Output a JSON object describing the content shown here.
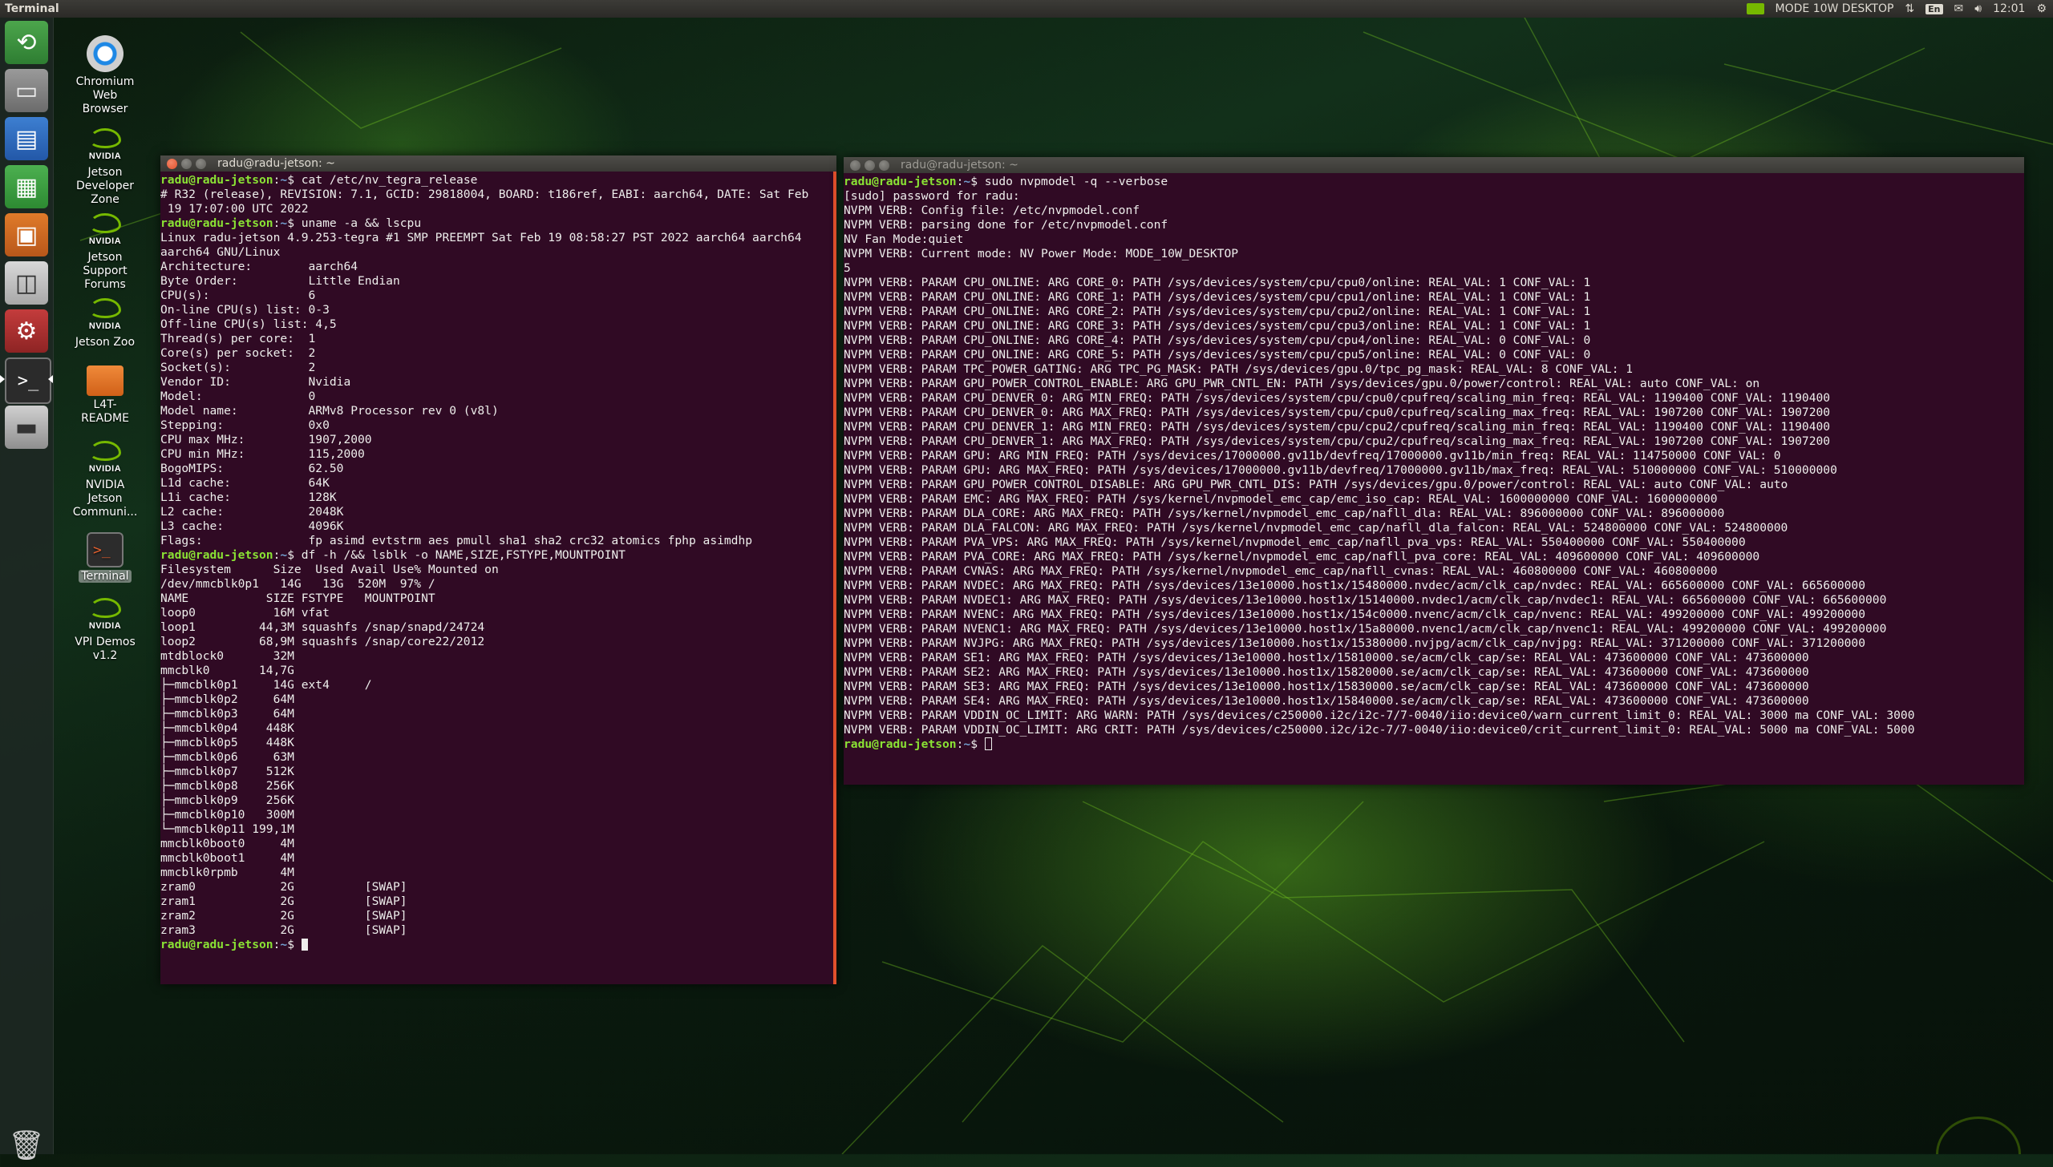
{
  "top_panel": {
    "app_title": "Terminal",
    "power_mode": "MODE 10W DESKTOP",
    "keyboard_layout": "En",
    "clock": "12:01"
  },
  "launcher": {
    "items": [
      "dash-home-icon",
      "files-icon",
      "libreoffice-writer-icon",
      "libreoffice-calc-icon",
      "libreoffice-impress-icon",
      "software-center-icon",
      "system-settings-icon",
      "terminal-icon",
      "drive-icon",
      "trash-icon"
    ]
  },
  "desktop": {
    "icons": [
      {
        "lines": [
          "Chromium",
          "Web",
          "Browser"
        ]
      },
      {
        "lines": [
          "Jetson",
          "Developer",
          "Zone"
        ]
      },
      {
        "lines": [
          "Jetson",
          "Support",
          "Forums"
        ]
      },
      {
        "lines": [
          "Jetson Zoo"
        ]
      },
      {
        "lines": [
          "L4T-",
          "README"
        ]
      },
      {
        "lines": [
          "NVIDIA",
          "Jetson",
          "Communi..."
        ]
      },
      {
        "lines": [
          "Terminal"
        ]
      },
      {
        "lines": [
          "VPI Demos",
          "v1.2"
        ]
      }
    ],
    "nvidia_label": "NVIDIA"
  },
  "terminal_left": {
    "title": "radu@radu-jetson: ~",
    "prompt_user": "radu@radu-jetson",
    "prompt_sep": ":",
    "prompt_path": "~",
    "prompt_end": "$ ",
    "lines": [
      {
        "p": true,
        "cmd": "cat /etc/nv_tegra_release"
      },
      {
        "t": "# R32 (release), REVISION: 7.1, GCID: 29818004, BOARD: t186ref, EABI: aarch64, DATE: Sat Feb"
      },
      {
        "t": " 19 17:07:00 UTC 2022"
      },
      {
        "p": true,
        "cmd": "uname -a && lscpu"
      },
      {
        "t": "Linux radu-jetson 4.9.253-tegra #1 SMP PREEMPT Sat Feb 19 08:58:27 PST 2022 aarch64 aarch64"
      },
      {
        "t": "aarch64 GNU/Linux"
      },
      {
        "t": "Architecture:        aarch64"
      },
      {
        "t": "Byte Order:          Little Endian"
      },
      {
        "t": "CPU(s):              6"
      },
      {
        "t": "On-line CPU(s) list: 0-3"
      },
      {
        "t": "Off-line CPU(s) list: 4,5"
      },
      {
        "t": "Thread(s) per core:  1"
      },
      {
        "t": "Core(s) per socket:  2"
      },
      {
        "t": "Socket(s):           2"
      },
      {
        "t": "Vendor ID:           Nvidia"
      },
      {
        "t": "Model:               0"
      },
      {
        "t": "Model name:          ARMv8 Processor rev 0 (v8l)"
      },
      {
        "t": "Stepping:            0x0"
      },
      {
        "t": "CPU max MHz:         1907,2000"
      },
      {
        "t": "CPU min MHz:         115,2000"
      },
      {
        "t": "BogoMIPS:            62.50"
      },
      {
        "t": "L1d cache:           64K"
      },
      {
        "t": "L1i cache:           128K"
      },
      {
        "t": "L2 cache:            2048K"
      },
      {
        "t": "L3 cache:            4096K"
      },
      {
        "t": "Flags:               fp asimd evtstrm aes pmull sha1 sha2 crc32 atomics fphp asimdhp"
      },
      {
        "p": true,
        "cmd": "df -h /&& lsblk -o NAME,SIZE,FSTYPE,MOUNTPOINT"
      },
      {
        "t": "Filesystem      Size  Used Avail Use% Mounted on"
      },
      {
        "t": "/dev/mmcblk0p1   14G   13G  520M  97% /"
      },
      {
        "t": "NAME           SIZE FSTYPE   MOUNTPOINT"
      },
      {
        "t": "loop0           16M vfat"
      },
      {
        "t": "loop1         44,3M squashfs /snap/snapd/24724"
      },
      {
        "t": "loop2         68,9M squashfs /snap/core22/2012"
      },
      {
        "t": "mtdblock0       32M"
      },
      {
        "t": "mmcblk0       14,7G"
      },
      {
        "t": "├─mmcblk0p1     14G ext4     /"
      },
      {
        "t": "├─mmcblk0p2     64M"
      },
      {
        "t": "├─mmcblk0p3     64M"
      },
      {
        "t": "├─mmcblk0p4    448K"
      },
      {
        "t": "├─mmcblk0p5    448K"
      },
      {
        "t": "├─mmcblk0p6     63M"
      },
      {
        "t": "├─mmcblk0p7    512K"
      },
      {
        "t": "├─mmcblk0p8    256K"
      },
      {
        "t": "├─mmcblk0p9    256K"
      },
      {
        "t": "├─mmcblk0p10   300M"
      },
      {
        "t": "└─mmcblk0p11 199,1M"
      },
      {
        "t": "mmcblk0boot0     4M"
      },
      {
        "t": "mmcblk0boot1     4M"
      },
      {
        "t": "mmcblk0rpmb      4M"
      },
      {
        "t": "zram0            2G          [SWAP]"
      },
      {
        "t": "zram1            2G          [SWAP]"
      },
      {
        "t": "zram2            2G          [SWAP]"
      },
      {
        "t": "zram3            2G          [SWAP]"
      },
      {
        "p": true,
        "cmd": "",
        "cursor": true
      }
    ]
  },
  "terminal_right": {
    "title": "radu@radu-jetson: ~",
    "prompt_user": "radu@radu-jetson",
    "prompt_sep": ":",
    "prompt_path": "~",
    "prompt_end": "$ ",
    "lines": [
      {
        "p": true,
        "cmd": "sudo nvpmodel -q --verbose"
      },
      {
        "t": "[sudo] password for radu:"
      },
      {
        "t": "NVPM VERB: Config file: /etc/nvpmodel.conf"
      },
      {
        "t": "NVPM VERB: parsing done for /etc/nvpmodel.conf"
      },
      {
        "t": "NV Fan Mode:quiet"
      },
      {
        "t": "NVPM VERB: Current mode: NV Power Mode: MODE_10W_DESKTOP"
      },
      {
        "t": "5"
      },
      {
        "t": "NVPM VERB: PARAM CPU_ONLINE: ARG CORE_0: PATH /sys/devices/system/cpu/cpu0/online: REAL_VAL: 1 CONF_VAL: 1"
      },
      {
        "t": "NVPM VERB: PARAM CPU_ONLINE: ARG CORE_1: PATH /sys/devices/system/cpu/cpu1/online: REAL_VAL: 1 CONF_VAL: 1"
      },
      {
        "t": "NVPM VERB: PARAM CPU_ONLINE: ARG CORE_2: PATH /sys/devices/system/cpu/cpu2/online: REAL_VAL: 1 CONF_VAL: 1"
      },
      {
        "t": "NVPM VERB: PARAM CPU_ONLINE: ARG CORE_3: PATH /sys/devices/system/cpu/cpu3/online: REAL_VAL: 1 CONF_VAL: 1"
      },
      {
        "t": "NVPM VERB: PARAM CPU_ONLINE: ARG CORE_4: PATH /sys/devices/system/cpu/cpu4/online: REAL_VAL: 0 CONF_VAL: 0"
      },
      {
        "t": "NVPM VERB: PARAM CPU_ONLINE: ARG CORE_5: PATH /sys/devices/system/cpu/cpu5/online: REAL_VAL: 0 CONF_VAL: 0"
      },
      {
        "t": "NVPM VERB: PARAM TPC_POWER_GATING: ARG TPC_PG_MASK: PATH /sys/devices/gpu.0/tpc_pg_mask: REAL_VAL: 8 CONF_VAL: 1"
      },
      {
        "t": "NVPM VERB: PARAM GPU_POWER_CONTROL_ENABLE: ARG GPU_PWR_CNTL_EN: PATH /sys/devices/gpu.0/power/control: REAL_VAL: auto CONF_VAL: on"
      },
      {
        "t": "NVPM VERB: PARAM CPU_DENVER_0: ARG MIN_FREQ: PATH /sys/devices/system/cpu/cpu0/cpufreq/scaling_min_freq: REAL_VAL: 1190400 CONF_VAL: 1190400"
      },
      {
        "t": "NVPM VERB: PARAM CPU_DENVER_0: ARG MAX_FREQ: PATH /sys/devices/system/cpu/cpu0/cpufreq/scaling_max_freq: REAL_VAL: 1907200 CONF_VAL: 1907200"
      },
      {
        "t": "NVPM VERB: PARAM CPU_DENVER_1: ARG MIN_FREQ: PATH /sys/devices/system/cpu/cpu2/cpufreq/scaling_min_freq: REAL_VAL: 1190400 CONF_VAL: 1190400"
      },
      {
        "t": "NVPM VERB: PARAM CPU_DENVER_1: ARG MAX_FREQ: PATH /sys/devices/system/cpu/cpu2/cpufreq/scaling_max_freq: REAL_VAL: 1907200 CONF_VAL: 1907200"
      },
      {
        "t": "NVPM VERB: PARAM GPU: ARG MIN_FREQ: PATH /sys/devices/17000000.gv11b/devfreq/17000000.gv11b/min_freq: REAL_VAL: 114750000 CONF_VAL: 0"
      },
      {
        "t": "NVPM VERB: PARAM GPU: ARG MAX_FREQ: PATH /sys/devices/17000000.gv11b/devfreq/17000000.gv11b/max_freq: REAL_VAL: 510000000 CONF_VAL: 510000000"
      },
      {
        "t": "NVPM VERB: PARAM GPU_POWER_CONTROL_DISABLE: ARG GPU_PWR_CNTL_DIS: PATH /sys/devices/gpu.0/power/control: REAL_VAL: auto CONF_VAL: auto"
      },
      {
        "t": "NVPM VERB: PARAM EMC: ARG MAX_FREQ: PATH /sys/kernel/nvpmodel_emc_cap/emc_iso_cap: REAL_VAL: 1600000000 CONF_VAL: 1600000000"
      },
      {
        "t": "NVPM VERB: PARAM DLA_CORE: ARG MAX_FREQ: PATH /sys/kernel/nvpmodel_emc_cap/nafll_dla: REAL_VAL: 896000000 CONF_VAL: 896000000"
      },
      {
        "t": "NVPM VERB: PARAM DLA_FALCON: ARG MAX_FREQ: PATH /sys/kernel/nvpmodel_emc_cap/nafll_dla_falcon: REAL_VAL: 524800000 CONF_VAL: 524800000"
      },
      {
        "t": "NVPM VERB: PARAM PVA_VPS: ARG MAX_FREQ: PATH /sys/kernel/nvpmodel_emc_cap/nafll_pva_vps: REAL_VAL: 550400000 CONF_VAL: 550400000"
      },
      {
        "t": "NVPM VERB: PARAM PVA_CORE: ARG MAX_FREQ: PATH /sys/kernel/nvpmodel_emc_cap/nafll_pva_core: REAL_VAL: 409600000 CONF_VAL: 409600000"
      },
      {
        "t": "NVPM VERB: PARAM CVNAS: ARG MAX_FREQ: PATH /sys/kernel/nvpmodel_emc_cap/nafll_cvnas: REAL_VAL: 460800000 CONF_VAL: 460800000"
      },
      {
        "t": "NVPM VERB: PARAM NVDEC: ARG MAX_FREQ: PATH /sys/devices/13e10000.host1x/15480000.nvdec/acm/clk_cap/nvdec: REAL_VAL: 665600000 CONF_VAL: 665600000"
      },
      {
        "t": "NVPM VERB: PARAM NVDEC1: ARG MAX_FREQ: PATH /sys/devices/13e10000.host1x/15140000.nvdec1/acm/clk_cap/nvdec1: REAL_VAL: 665600000 CONF_VAL: 665600000"
      },
      {
        "t": "NVPM VERB: PARAM NVENC: ARG MAX_FREQ: PATH /sys/devices/13e10000.host1x/154c0000.nvenc/acm/clk_cap/nvenc: REAL_VAL: 499200000 CONF_VAL: 499200000"
      },
      {
        "t": "NVPM VERB: PARAM NVENC1: ARG MAX_FREQ: PATH /sys/devices/13e10000.host1x/15a80000.nvenc1/acm/clk_cap/nvenc1: REAL_VAL: 499200000 CONF_VAL: 499200000"
      },
      {
        "t": "NVPM VERB: PARAM NVJPG: ARG MAX_FREQ: PATH /sys/devices/13e10000.host1x/15380000.nvjpg/acm/clk_cap/nvjpg: REAL_VAL: 371200000 CONF_VAL: 371200000"
      },
      {
        "t": "NVPM VERB: PARAM SE1: ARG MAX_FREQ: PATH /sys/devices/13e10000.host1x/15810000.se/acm/clk_cap/se: REAL_VAL: 473600000 CONF_VAL: 473600000"
      },
      {
        "t": "NVPM VERB: PARAM SE2: ARG MAX_FREQ: PATH /sys/devices/13e10000.host1x/15820000.se/acm/clk_cap/se: REAL_VAL: 473600000 CONF_VAL: 473600000"
      },
      {
        "t": "NVPM VERB: PARAM SE3: ARG MAX_FREQ: PATH /sys/devices/13e10000.host1x/15830000.se/acm/clk_cap/se: REAL_VAL: 473600000 CONF_VAL: 473600000"
      },
      {
        "t": "NVPM VERB: PARAM SE4: ARG MAX_FREQ: PATH /sys/devices/13e10000.host1x/15840000.se/acm/clk_cap/se: REAL_VAL: 473600000 CONF_VAL: 473600000"
      },
      {
        "t": "NVPM VERB: PARAM VDDIN_OC_LIMIT: ARG WARN: PATH /sys/devices/c250000.i2c/i2c-7/7-0040/iio:device0/warn_current_limit_0: REAL_VAL: 3000 ma CONF_VAL: 3000"
      },
      {
        "t": "NVPM VERB: PARAM VDDIN_OC_LIMIT: ARG CRIT: PATH /sys/devices/c250000.i2c/i2c-7/7-0040/iio:device0/crit_current_limit_0: REAL_VAL: 5000 ma CONF_VAL: 5000"
      },
      {
        "p": true,
        "cmd": "",
        "cursor": true,
        "hollow": true
      }
    ]
  },
  "colors": {
    "terminal_bg": "#300a24",
    "prompt_user": "#8ae234",
    "prompt_path": "#729fcf",
    "nvidia_green": "#76b900"
  }
}
